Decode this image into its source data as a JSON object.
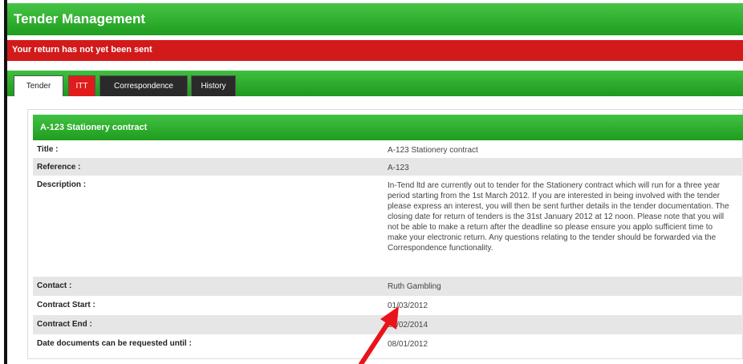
{
  "app": {
    "title": "Tender Management"
  },
  "alert": {
    "text": "Your return has not yet been sent"
  },
  "tabs": [
    {
      "label": "Tender",
      "active": true
    },
    {
      "label": "ITT"
    },
    {
      "label": "Correspondence"
    },
    {
      "label": "History"
    }
  ],
  "panel": {
    "heading": "A-123 Stationery contract",
    "fields": [
      {
        "label": "Title :",
        "value": "A-123 Stationery contract"
      },
      {
        "label": "Reference :",
        "value": "A-123"
      },
      {
        "label": "Description :",
        "value": "In-Tend ltd are currently out to tender for the Stationery contract which will run for a three year period starting from the 1st March 2012. If you are interested in being involved with the tender please express an interest, you will then be sent further details in the tender documentation. The closing date for return of tenders is the 31st January 2012 at 12 noon. Please note that you will not be able to make a return after the deadline so please ensure you applo sufficient time to make your electronic return. Any questions relating to the tender should be forwarded via the Correspondence functionality."
      },
      {
        "label": "Contact :",
        "value": "Ruth Gambling"
      },
      {
        "label": "Contract Start :",
        "value": "01/03/2012"
      },
      {
        "label": "Contract End :",
        "value": "28/02/2014"
      },
      {
        "label": "Date documents can be requested until :",
        "value": "08/01/2012"
      }
    ]
  },
  "colors": {
    "header_green": "#2eaa2e",
    "alert_red": "#d21a1a",
    "tab_dark": "#2a2a2a",
    "arrow_red": "#e8141a"
  }
}
